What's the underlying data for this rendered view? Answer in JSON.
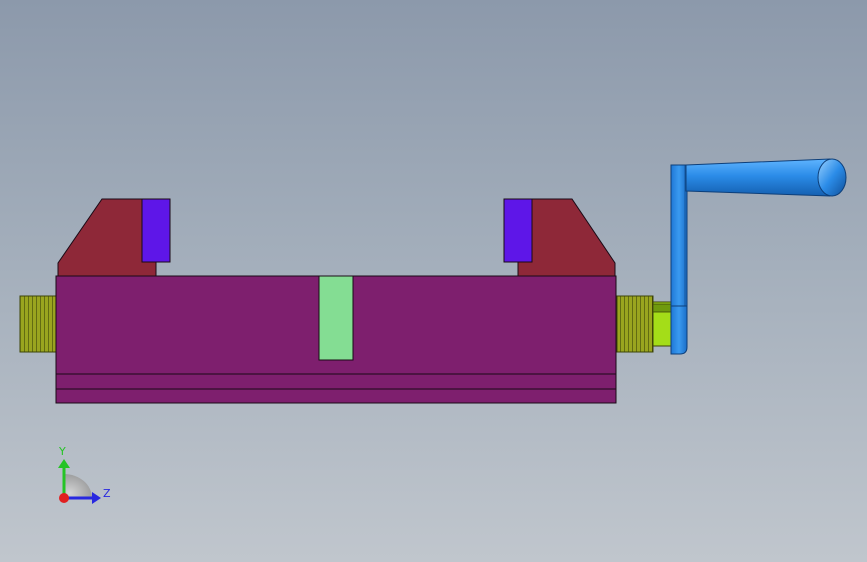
{
  "viewport": {
    "background_top": "#8c99ab",
    "background_bottom": "#c0c6cd"
  },
  "model": {
    "body_color": "#7e1f6e",
    "jaw_color": "#8e2838",
    "jaw_insert_color": "#5e16e8",
    "slot_color": "#84dd93",
    "thread_color": "#8f9a1c",
    "collar_color": "#a4dd18",
    "handle_color": "#2b8ce8",
    "outline_color": "#1a0a16"
  },
  "triad": {
    "y_label": "Y",
    "z_label": "Z",
    "y_color": "#25c425",
    "z_color": "#2828e0",
    "x_color": "#e02020"
  }
}
